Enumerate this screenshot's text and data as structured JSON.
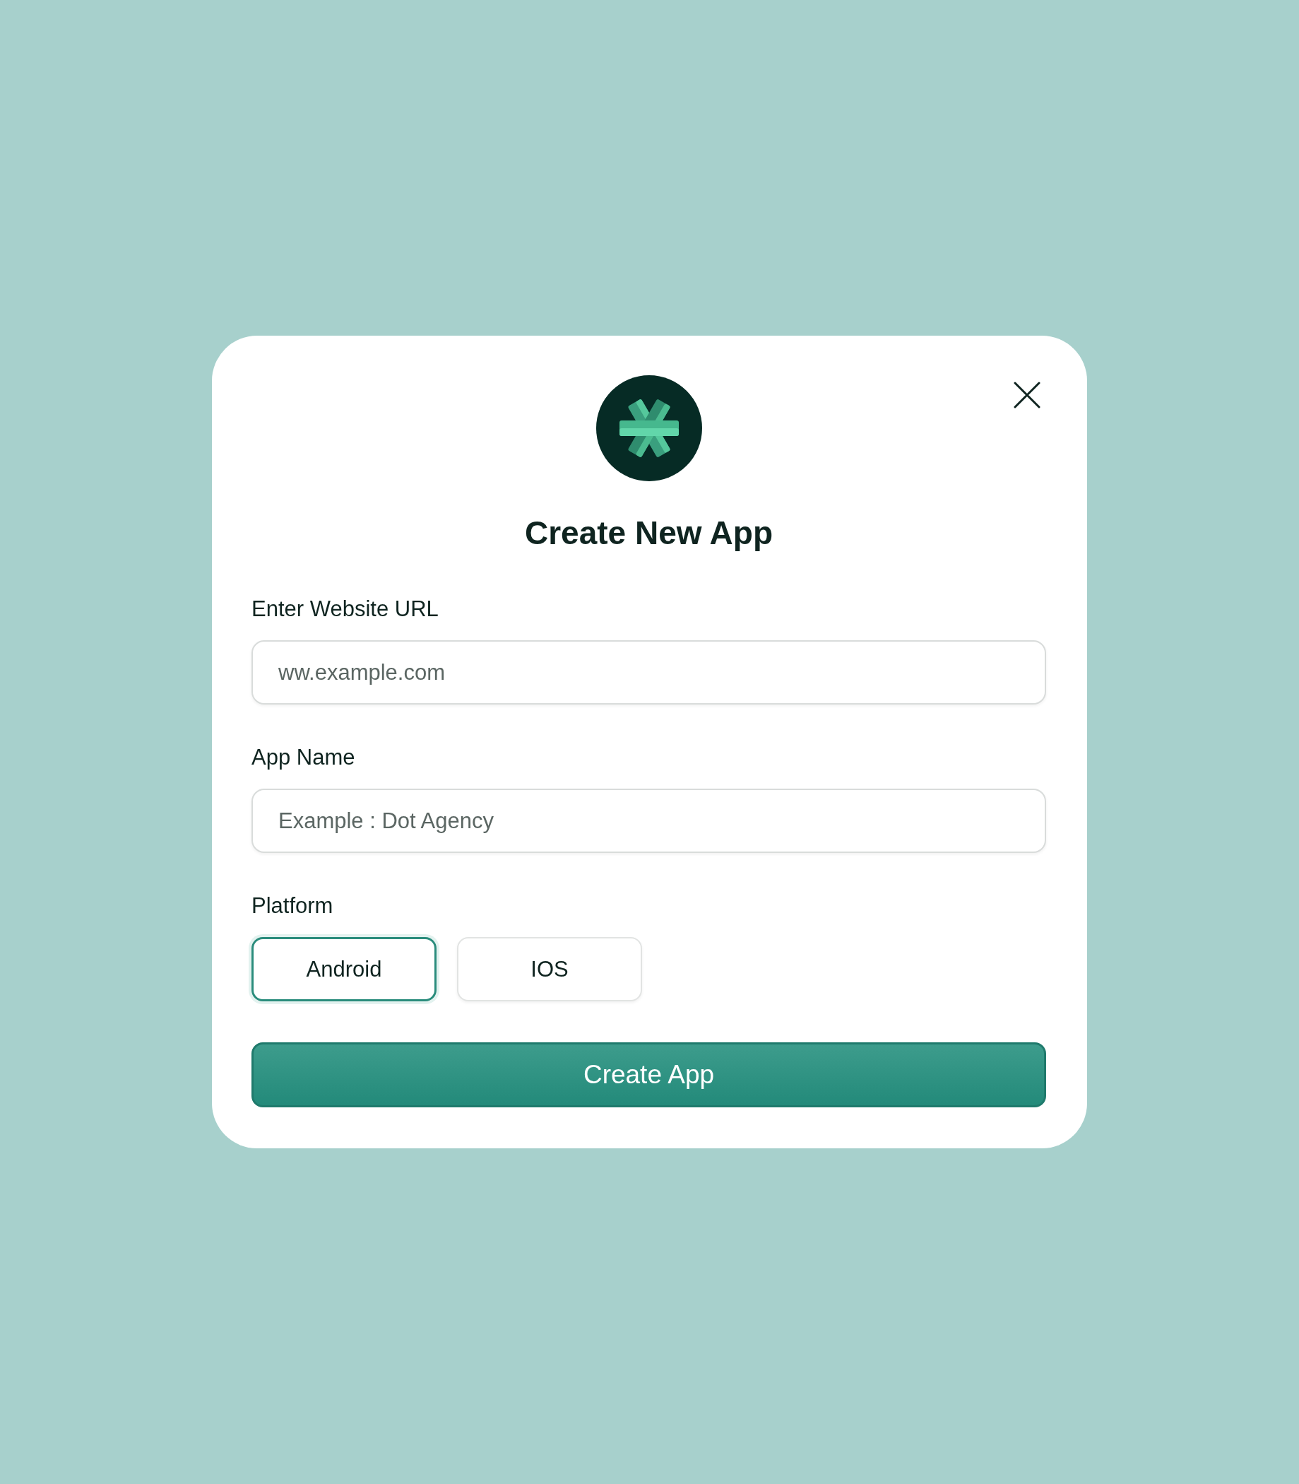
{
  "dialog": {
    "title": "Create New App"
  },
  "fields": [
    {
      "label": "Enter Website URL",
      "placeholder": "ww.example.com"
    },
    {
      "label": "App Name",
      "placeholder": "Example : Dot Agency"
    }
  ],
  "platform": {
    "label": "Platform",
    "options": [
      {
        "label": "Android",
        "selected": true
      },
      {
        "label": "IOS",
        "selected": false
      }
    ]
  },
  "submit": {
    "label": "Create App"
  }
}
